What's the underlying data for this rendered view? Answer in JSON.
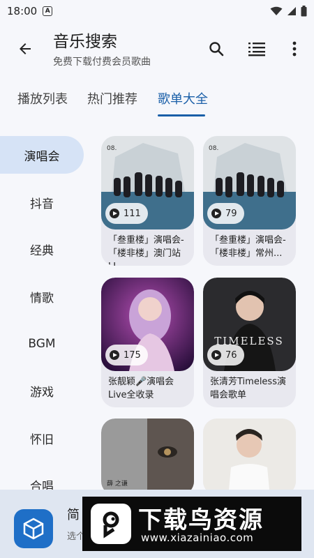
{
  "status": {
    "time": "18:00",
    "notif_badge": "A"
  },
  "appbar": {
    "title": "音乐搜索",
    "subtitle": "免费下载付费会员歌曲"
  },
  "tabs": [
    {
      "label": "播放列表"
    },
    {
      "label": "热门推荐"
    },
    {
      "label": "歌单大全",
      "active": true
    }
  ],
  "sidebar": {
    "items": [
      {
        "label": "演唱会",
        "active": true
      },
      {
        "label": "抖音"
      },
      {
        "label": "经典"
      },
      {
        "label": "情歌"
      },
      {
        "label": "BGM"
      },
      {
        "label": "游戏"
      },
      {
        "label": "怀旧"
      },
      {
        "label": "合唱"
      }
    ]
  },
  "playlists": [
    {
      "title": "「叁重楼」演唱会-「楼非楼」澳门站LI",
      "plays": "111"
    },
    {
      "title": "「叁重楼」演唱会-「楼非楼」常州...",
      "plays": "79"
    },
    {
      "title": "张靓颖🎤演唱会Live全收录",
      "plays": "175"
    },
    {
      "title": "张清芳Timeless演唱会歌单",
      "plays": "76"
    },
    {
      "title": "",
      "plays": ""
    },
    {
      "title": "",
      "plays": ""
    }
  ],
  "bottom_bar": {
    "title": "简",
    "subtitle": "选个"
  },
  "watermark": {
    "title": "下载鸟资源",
    "url": "www.xiazainiao.com"
  },
  "colors": {
    "accent": "#1a5fa8",
    "active_bg": "#d6e3f6",
    "background": "#f6f7fb"
  }
}
